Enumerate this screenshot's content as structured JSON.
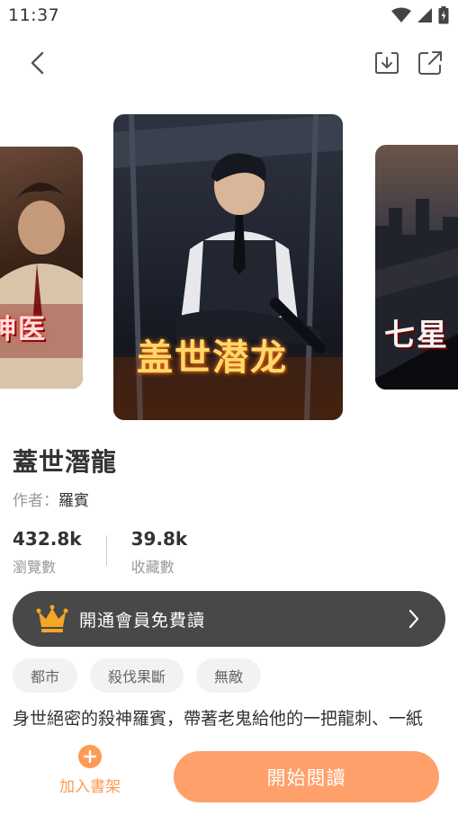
{
  "status_bar": {
    "time": "11:37",
    "icons": [
      "wifi-icon",
      "cellular-signal-icon",
      "battery-charging-icon"
    ]
  },
  "nav": {
    "icons": [
      "chevron-left-icon",
      "download-icon",
      "share-icon"
    ]
  },
  "carousel": {
    "covers": [
      {
        "title_text": "神医"
      },
      {
        "title_text": "盖世潜龙"
      },
      {
        "title_text": "七星"
      }
    ]
  },
  "book": {
    "title": "蓋世潛龍",
    "author_label": "作者：",
    "author_name": "羅賓"
  },
  "stats": {
    "views_value": "432.8k",
    "views_label": "瀏覽數",
    "favorites_value": "39.8k",
    "favorites_label": "收藏數"
  },
  "vip_banner": {
    "text": "開通會員免費讀",
    "icon": "crown-icon",
    "accent": "#f5a623"
  },
  "tags": [
    "都市",
    "殺伐果斷",
    "無敵"
  ],
  "synopsis": "身世絕密的殺神羅賓，帶著老鬼給他的一把龍刺、一紙",
  "bottom_bar": {
    "shelf_label": "加入書架",
    "read_label": "開始閱讀",
    "accent": "#ffa06a"
  }
}
